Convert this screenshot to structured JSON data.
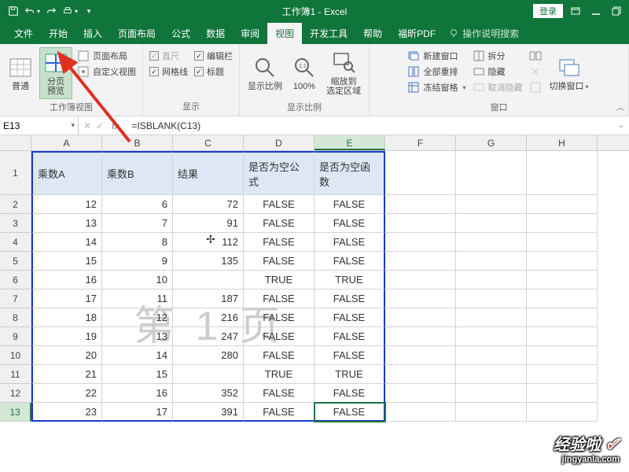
{
  "title": "工作簿1 - Excel",
  "login": "登录",
  "menu": {
    "file": "文件",
    "home": "开始",
    "insert": "插入",
    "pagelayout": "页面布局",
    "formulas": "公式",
    "data": "数据",
    "review": "审阅",
    "view": "视图",
    "dev": "开发工具",
    "help": "帮助",
    "foxit": "福昕PDF",
    "tellme": "操作说明搜索"
  },
  "ribbon": {
    "g1": {
      "label": "工作簿视图",
      "normal": "普通",
      "pagebreak": "分页\n预览",
      "pagelayout": "页面布局",
      "custom": "自定义视图"
    },
    "g2": {
      "label": "显示",
      "ruler": "直尺",
      "formulabar": "编辑栏",
      "gridlines": "网格线",
      "headings": "标题"
    },
    "g3": {
      "label": "显示比例",
      "zoom": "显示比例",
      "hundred": "100%",
      "zoomselection": "缩放到\n选定区域"
    },
    "g4": {
      "label": "窗口",
      "newwin": "新建窗口",
      "arrange": "全部重排",
      "freeze": "冻结窗格",
      "split": "拆分",
      "hide": "隐藏",
      "unhide": "取消隐藏",
      "switch": "切换窗口"
    }
  },
  "namebox": "E13",
  "formula": "=ISBLANK(C13)",
  "cols": [
    "A",
    "B",
    "C",
    "D",
    "E",
    "F",
    "G",
    "H"
  ],
  "headers": {
    "a": "乘数A",
    "b": "乘数B",
    "c": "结果",
    "d": "是否为空公式",
    "e": "是否为空函数"
  },
  "watermark": "第 1 页",
  "rows": [
    {
      "n": 2,
      "a": "12",
      "b": "6",
      "c": "72",
      "d": "FALSE",
      "e": "FALSE"
    },
    {
      "n": 3,
      "a": "13",
      "b": "7",
      "c": "91",
      "d": "FALSE",
      "e": "FALSE"
    },
    {
      "n": 4,
      "a": "14",
      "b": "8",
      "c": "112",
      "d": "FALSE",
      "e": "FALSE"
    },
    {
      "n": 5,
      "a": "15",
      "b": "9",
      "c": "135",
      "d": "FALSE",
      "e": "FALSE"
    },
    {
      "n": 6,
      "a": "16",
      "b": "10",
      "c": "",
      "d": "TRUE",
      "e": "TRUE"
    },
    {
      "n": 7,
      "a": "17",
      "b": "11",
      "c": "187",
      "d": "FALSE",
      "e": "FALSE"
    },
    {
      "n": 8,
      "a": "18",
      "b": "12",
      "c": "216",
      "d": "FALSE",
      "e": "FALSE"
    },
    {
      "n": 9,
      "a": "19",
      "b": "13",
      "c": "247",
      "d": "FALSE",
      "e": "FALSE"
    },
    {
      "n": 10,
      "a": "20",
      "b": "14",
      "c": "280",
      "d": "FALSE",
      "e": "FALSE"
    },
    {
      "n": 11,
      "a": "21",
      "b": "15",
      "c": "",
      "d": "TRUE",
      "e": "TRUE"
    },
    {
      "n": 12,
      "a": "22",
      "b": "16",
      "c": "352",
      "d": "FALSE",
      "e": "FALSE"
    },
    {
      "n": 13,
      "a": "23",
      "b": "17",
      "c": "391",
      "d": "FALSE",
      "e": "FALSE"
    }
  ],
  "logo": {
    "main": "经验啦",
    "sub": "jingyanla.com"
  }
}
